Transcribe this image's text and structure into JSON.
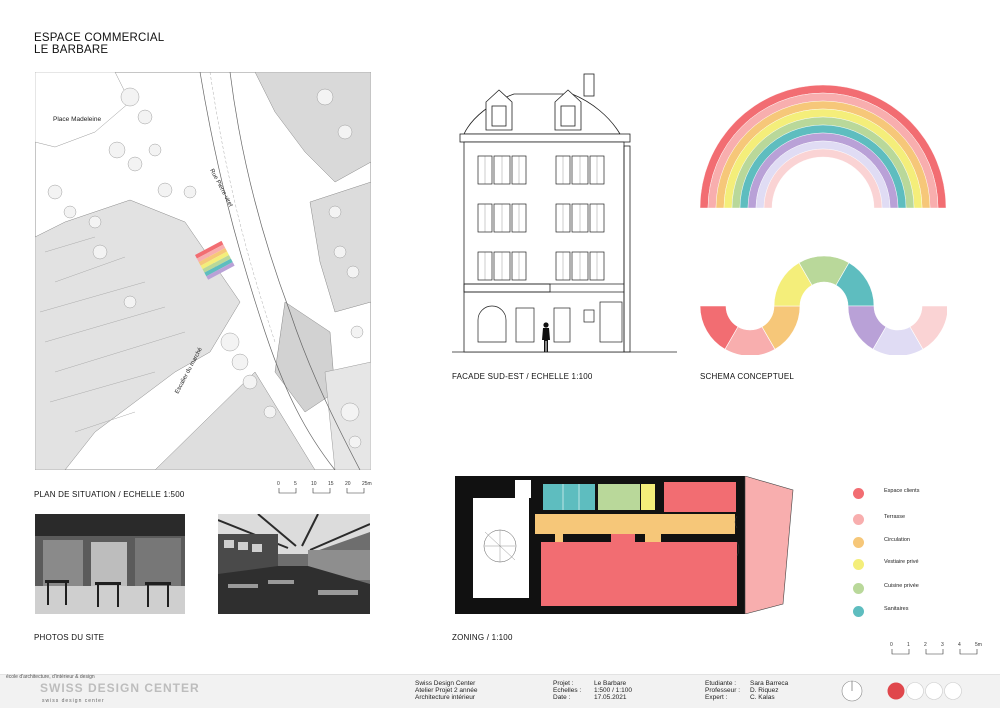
{
  "title_lines": [
    "ESPACE COMMERCIAL",
    "LE BARBARE"
  ],
  "site_plan": {
    "labels": {
      "place": "Place Madeleine",
      "street": "Rue Pierre-viret",
      "stairs": "Escalier du marché"
    },
    "caption": "PLAN DE SITUATION / ECHELLE 1:500",
    "scale_ticks": [
      "0",
      "5",
      "10",
      "15",
      "20",
      "25m"
    ]
  },
  "facade": {
    "caption": "FACADE SUD-EST / ECHELLE 1:100"
  },
  "schema": {
    "caption": "SCHEMA CONCEPTUEL",
    "rainbow_colors": [
      "#f26d72",
      "#f8aeae",
      "#f6c779",
      "#f4ee7a",
      "#b9d89a",
      "#5ebdbf",
      "#b9a1d7",
      "#e0dcf4",
      "#fad3d4"
    ],
    "wave_colors": [
      "#f26d72",
      "#f8aeae",
      "#f6c779",
      "#f4ee7a",
      "#b9d89a",
      "#5ebdbf",
      "#b9a1d7",
      "#e0dcf4",
      "#fad3d4"
    ]
  },
  "photos": {
    "caption": "PHOTOS DU SITE"
  },
  "zoning": {
    "caption": "ZONING / 1:100",
    "scale_ticks": [
      "0",
      "1",
      "2",
      "3",
      "4",
      "5m"
    ],
    "legend": [
      {
        "label": "Espace clients",
        "color": "#f26d72"
      },
      {
        "label": "Terrasse",
        "color": "#f8aeae"
      },
      {
        "label": "Circulation",
        "color": "#f6c779"
      },
      {
        "label": "Vestiaire privé",
        "color": "#f4ee7a"
      },
      {
        "label": "Cuisine privée",
        "color": "#b9d89a"
      },
      {
        "label": "Sanitaires",
        "color": "#5ebdbf"
      }
    ]
  },
  "footer": {
    "school_tagline": "école d'architecture, d'intérieur & design",
    "school_logo": "SWISS DESIGN CENTER",
    "school_subline": "swiss design center",
    "org_lines": [
      "Swiss Design Center",
      "Atelier Projet 2 année",
      "Architecture intérieur"
    ],
    "project_keys": [
      "Projet :",
      "Echelles :",
      "Date :"
    ],
    "project_values": [
      "Le Barbare",
      "1:500 / 1:100",
      "17.05.2021"
    ],
    "people_keys": [
      "Etudiante :",
      "Professeur :",
      "Expert :"
    ],
    "people_values": [
      "Sara Barreca",
      "D. Riquez",
      "C. Kalas"
    ]
  }
}
